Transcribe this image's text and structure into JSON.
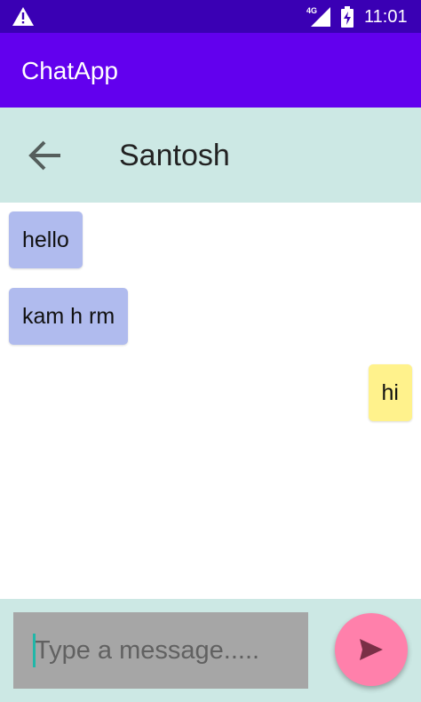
{
  "status_bar": {
    "network_label": "4G",
    "time": "11:01",
    "icons": [
      "warning-icon",
      "signal-icon",
      "battery-charging-icon"
    ]
  },
  "app_bar": {
    "title": "ChatApp",
    "color": "#6200ee"
  },
  "chat_header": {
    "contact_name": "Santosh",
    "back_icon": "arrow-left-icon",
    "color": "#cce8e4"
  },
  "messages": [
    {
      "text": "hello",
      "direction": "received",
      "color": "#b0bbee"
    },
    {
      "text": "kam h rm",
      "direction": "received",
      "color": "#b0bbee"
    },
    {
      "text": "hi",
      "direction": "sent",
      "color": "#fff28c"
    }
  ],
  "composer": {
    "placeholder": "Type a message.....",
    "value": "",
    "send_icon": "send-icon",
    "send_color": "#ff80ab"
  }
}
